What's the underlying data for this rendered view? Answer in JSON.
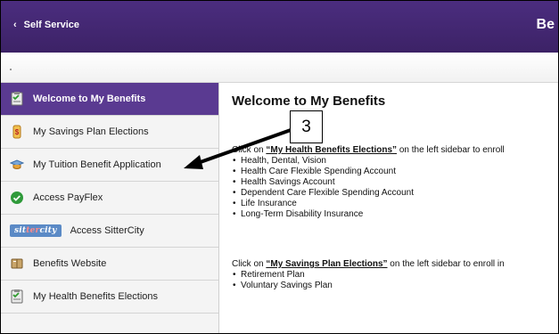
{
  "header": {
    "back_label": "Self Service",
    "title": "Be"
  },
  "sidebar": {
    "items": [
      {
        "label": "Welcome to My Benefits",
        "icon": "checklist-icon",
        "active": true
      },
      {
        "label": "My Savings Plan Elections",
        "icon": "piggy-bank-icon",
        "active": false
      },
      {
        "label": "My Tuition Benefit Application",
        "icon": "mortarboard-icon",
        "active": false
      },
      {
        "label": "Access PayFlex",
        "icon": "green-check-icon",
        "active": false
      },
      {
        "label": "Access SitterCity",
        "icon": "sittercity-logo",
        "logo_text_a": "sit",
        "logo_text_b": "ter",
        "logo_text_c": "city",
        "active": false
      },
      {
        "label": "Benefits Website",
        "icon": "book-icon",
        "active": false
      },
      {
        "label": "My Health Benefits Elections",
        "icon": "checklist-icon",
        "active": false
      }
    ]
  },
  "main": {
    "title": "Welcome to My Benefits",
    "para1_prefix": "Click on ",
    "para1_link": "“My Health Benefits Elections”",
    "para1_suffix": " on the left sidebar to enroll",
    "list1": [
      "Health, Dental, Vision",
      "Health Care Flexible Spending Account",
      "Health Savings Account",
      "Dependent Care Flexible Spending Account",
      "Life Insurance",
      "Long-Term Disability Insurance"
    ],
    "para2_prefix": "Click on ",
    "para2_link": "“My Savings Plan Elections”",
    "para2_suffix": " on the left sidebar to enroll in",
    "list2": [
      "Retirement Plan",
      "Voluntary Savings Plan"
    ]
  },
  "annotation": {
    "callout_number": "3"
  },
  "colors": {
    "header_purple": "#4b2d7f",
    "active_item": "#5a3a91",
    "sidebar_bg": "#f4f4f4"
  }
}
